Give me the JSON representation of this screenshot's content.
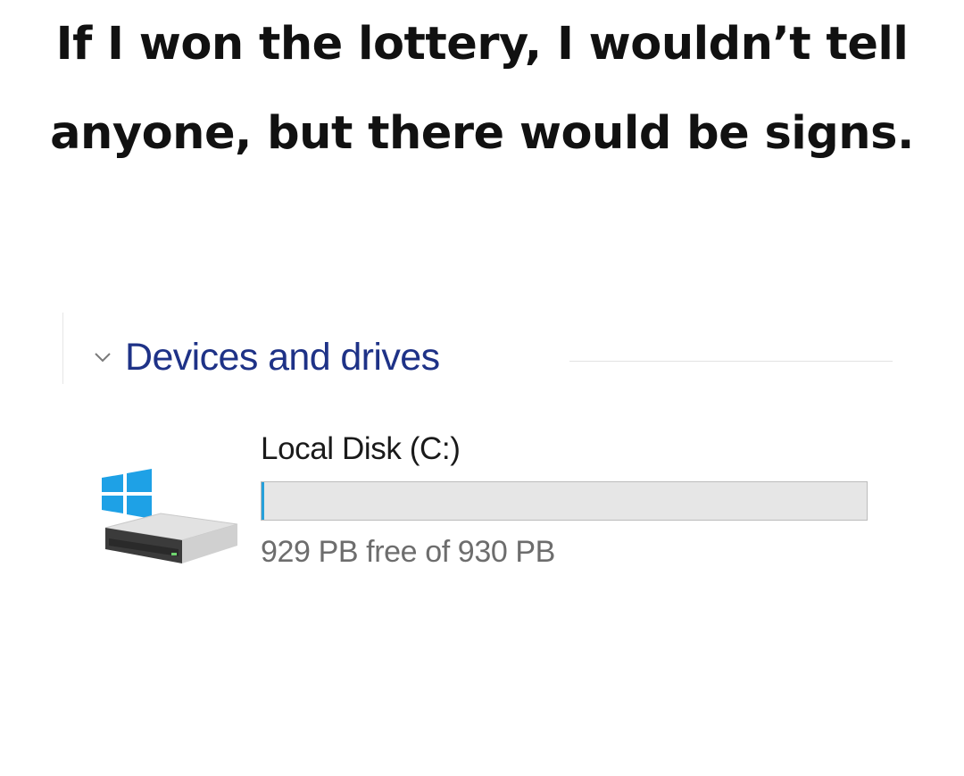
{
  "caption": {
    "line1": "If I won the lottery, I wouldn’t tell",
    "line2": "anyone, but there would be signs."
  },
  "section": {
    "title": "Devices and drives",
    "chevron_icon": "chevron-down-icon"
  },
  "drive": {
    "name": "Local Disk (C:)",
    "icon": "windows-drive-icon",
    "free_text": "929 PB free of 930 PB",
    "used_fraction": 0.0011
  },
  "colors": {
    "caption_text": "#111111",
    "section_title": "#1e3287",
    "bar_fill": "#26a0da",
    "bar_track": "#e6e6e6",
    "windows_logo": "#1ea1e6"
  }
}
